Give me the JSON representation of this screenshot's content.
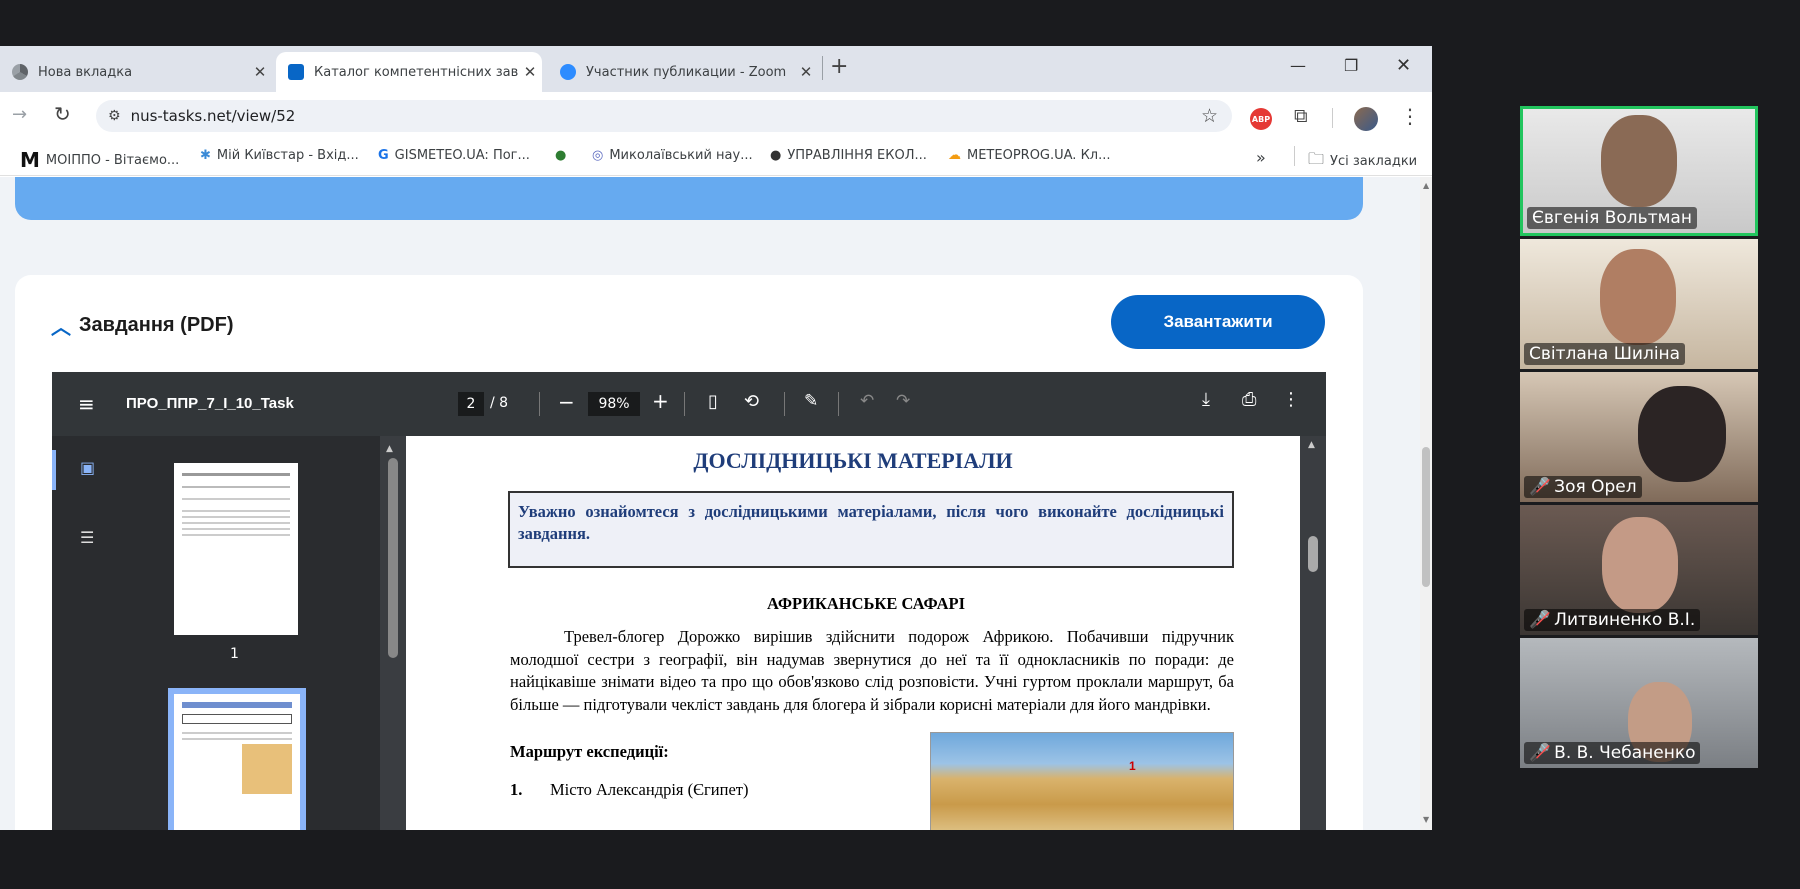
{
  "tabs": [
    {
      "label": "Нова вкладка",
      "icon": "chrome-icon"
    },
    {
      "label": "Каталог компетентнісних завд",
      "icon": "catalog-icon"
    },
    {
      "label": "Участник публикации - Zoom",
      "icon": "zoom-icon"
    }
  ],
  "new_tab": "+",
  "window": {
    "minimize": "—",
    "restore": "❐",
    "close": "✕"
  },
  "address": {
    "url": "nus-tasks.net/view/52"
  },
  "bookmarks": [
    {
      "label": "МОІППО - Вітаємо...",
      "icon": "M"
    },
    {
      "label": "Мій Київстар - Вхід...",
      "icon": "✱"
    },
    {
      "label": "GISMETEO.UA: Пог...",
      "icon": "G"
    },
    {
      "label": "",
      "icon": "●"
    },
    {
      "label": "Миколаївський нау...",
      "icon": "◎"
    },
    {
      "label": "УПРАВЛІННЯ ЕКОЛ...",
      "icon": "●"
    },
    {
      "label": "METEOPROG.UA. Кл...",
      "icon": "☁"
    }
  ],
  "bookmarks_more": "»",
  "all_bookmarks": "Усі закладки",
  "abp": "ABP",
  "section": {
    "title": "Завдання (PDF)",
    "download_button": "Завантажити"
  },
  "pdf": {
    "filename": "ПРО_ППР_7_І_10_Task",
    "page_current": "2",
    "page_total": "/  8",
    "zoom": "98%",
    "thumb1_num": "1",
    "heading": "ДОСЛІДНИЦЬКІ МАТЕРІАЛИ",
    "instruction": "Уважно ознайомтеся з дослідницькими матеріалами, після чого виконайте дослідницькі завдання.",
    "subheading": "АФРИКАНСЬКЕ САФАРІ",
    "paragraph": "Тревел-блогер Дорожко вирішив здійснити подорож Африкою. Побачивши підручник молодшої сестри з географії, він надумав звернутися до неї та її однокласників по поради: де найцікавіше знімати відео та про що обов'язково слід розповісти. Учні гуртом проклали маршрут, ба більше — підготували чекліст завдань для блогера й зібрали корисні матеріали для його мандрівки.",
    "route_title": "Маршрут експедиції:",
    "route_item_num": "1.",
    "route_item": "Місто Александрія (Єгипет)",
    "map_marker": "1"
  },
  "participants": [
    {
      "name": "Євгенія Вольтман",
      "muted": false,
      "active": true
    },
    {
      "name": "Світлана Шиліна",
      "muted": false,
      "active": false
    },
    {
      "name": "Зоя Орел",
      "muted": true,
      "active": false
    },
    {
      "name": "Литвиненко В.І.",
      "muted": true,
      "active": false
    },
    {
      "name": "В. В. Чебаненко",
      "muted": true,
      "active": false
    }
  ],
  "colors": {
    "accent": "#0866c6",
    "banner": "#66aaf0",
    "pdf_heading": "#1f3d7a",
    "active_speaker": "#22c55e"
  }
}
